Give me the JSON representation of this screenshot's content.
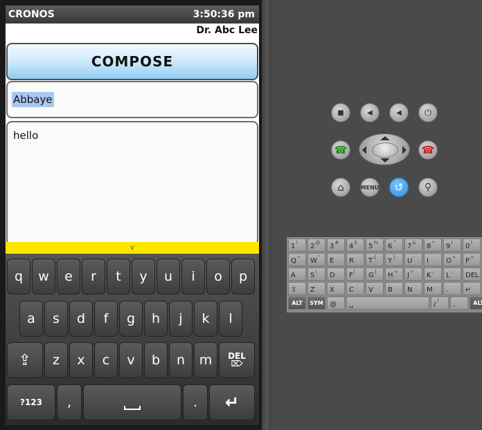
{
  "status_bar": {
    "app_name": "CRONOS",
    "time": "3:50:36 pm"
  },
  "header": {
    "user_name": "Dr. Abc Lee",
    "title": "COMPOSE"
  },
  "compose": {
    "to_value": "Abbaye",
    "message_value": "hello"
  },
  "keyboard": {
    "handle_glyph": "⋎",
    "row1": [
      "q",
      "w",
      "e",
      "r",
      "t",
      "y",
      "u",
      "i",
      "o",
      "p"
    ],
    "row2": [
      "a",
      "s",
      "d",
      "f",
      "g",
      "h",
      "j",
      "k",
      "l"
    ],
    "row3": [
      "z",
      "x",
      "c",
      "v",
      "b",
      "n",
      "m"
    ],
    "shift_icon": "⇪",
    "delete_label": "DEL",
    "symbols_label": "?123",
    "comma": ",",
    "period": ".",
    "enter_icon": "↵"
  },
  "emulator": {
    "buttons": {
      "camera": "■",
      "vol_down": "◀",
      "vol_up": "◀",
      "power": "⏻",
      "call": "☎",
      "end_call": "☎",
      "home": "⌂",
      "menu": "MENU",
      "back": "↺",
      "search": "⚲"
    },
    "hw_keyboard": {
      "row1": [
        {
          "k": "1",
          "s": "!"
        },
        {
          "k": "2",
          "s": "@"
        },
        {
          "k": "3",
          "s": "#"
        },
        {
          "k": "4",
          "s": "$"
        },
        {
          "k": "5",
          "s": "%"
        },
        {
          "k": "6",
          "s": "^"
        },
        {
          "k": "7",
          "s": "&"
        },
        {
          "k": "8",
          "s": "*"
        },
        {
          "k": "9",
          "s": "("
        },
        {
          "k": "0",
          "s": ")"
        }
      ],
      "row2": [
        {
          "k": "Q",
          "s": "~"
        },
        {
          "k": "W",
          "s": "\""
        },
        {
          "k": "E",
          "s": ""
        },
        {
          "k": "R",
          "s": ""
        },
        {
          "k": "T",
          "s": "{"
        },
        {
          "k": "Y",
          "s": "}"
        },
        {
          "k": "U",
          "s": "-"
        },
        {
          "k": "I",
          "s": ""
        },
        {
          "k": "O",
          "s": "+"
        },
        {
          "k": "P",
          "s": "="
        }
      ],
      "row3": [
        {
          "k": "A",
          "s": ""
        },
        {
          "k": "S",
          "s": "\\"
        },
        {
          "k": "D",
          "s": ""
        },
        {
          "k": "F",
          "s": "["
        },
        {
          "k": "G",
          "s": "]"
        },
        {
          "k": "H",
          "s": "<"
        },
        {
          "k": "J",
          "s": ">"
        },
        {
          "k": "K",
          "s": ";"
        },
        {
          "k": "L",
          "s": ":"
        },
        {
          "k": "DEL",
          "s": ""
        }
      ],
      "row4": [
        {
          "k": "⇪",
          "s": ""
        },
        {
          "k": "Z",
          "s": ""
        },
        {
          "k": "X",
          "s": ""
        },
        {
          "k": "C",
          "s": ""
        },
        {
          "k": "V",
          "s": ""
        },
        {
          "k": "B",
          "s": ""
        },
        {
          "k": "N",
          "s": ""
        },
        {
          "k": "M",
          "s": ""
        },
        {
          "k": ".",
          "s": ""
        },
        {
          "k": "↵",
          "s": ""
        }
      ],
      "row5": [
        {
          "k": "ALT",
          "s": ""
        },
        {
          "k": "SYM",
          "s": ""
        },
        {
          "k": "@",
          "s": ""
        },
        {
          "k": "␣",
          "s": ""
        },
        {
          "k": "/",
          "s": "?"
        },
        {
          "k": ",",
          "s": ""
        },
        {
          "k": "ALT",
          "s": ""
        }
      ]
    }
  }
}
